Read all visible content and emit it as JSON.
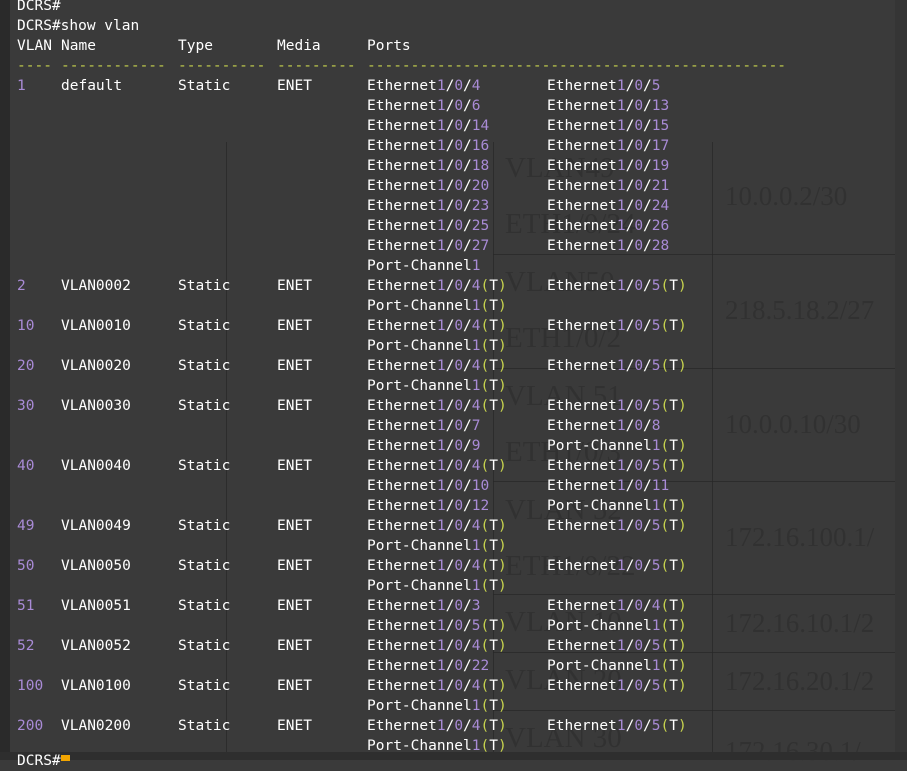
{
  "header_lines": [
    "DCRS#",
    "DCRS#show vlan"
  ],
  "columns": [
    "VLAN",
    "Name",
    "Type",
    "Media",
    "Ports"
  ],
  "separators": [
    "----",
    "------------",
    "----------",
    "---------",
    "------------------------------------------------"
  ],
  "vlans": [
    {
      "id": "1",
      "name": "default",
      "type": "Static",
      "media": "ENET",
      "port_lines": [
        [
          "Ethernet1/0/4",
          "Ethernet1/0/5"
        ],
        [
          "Ethernet1/0/6",
          "Ethernet1/0/13"
        ],
        [
          "Ethernet1/0/14",
          "Ethernet1/0/15"
        ],
        [
          "Ethernet1/0/16",
          "Ethernet1/0/17"
        ],
        [
          "Ethernet1/0/18",
          "Ethernet1/0/19"
        ],
        [
          "Ethernet1/0/20",
          "Ethernet1/0/21"
        ],
        [
          "Ethernet1/0/23",
          "Ethernet1/0/24"
        ],
        [
          "Ethernet1/0/25",
          "Ethernet1/0/26"
        ],
        [
          "Ethernet1/0/27",
          "Ethernet1/0/28"
        ],
        [
          "Port-Channel1"
        ]
      ]
    },
    {
      "id": "2",
      "name": "VLAN0002",
      "type": "Static",
      "media": "ENET",
      "port_lines": [
        [
          "Ethernet1/0/4(T)",
          "Ethernet1/0/5(T)"
        ],
        [
          "Port-Channel1(T)"
        ]
      ]
    },
    {
      "id": "10",
      "name": "VLAN0010",
      "type": "Static",
      "media": "ENET",
      "port_lines": [
        [
          "Ethernet1/0/4(T)",
          "Ethernet1/0/5(T)"
        ],
        [
          "Port-Channel1(T)"
        ]
      ]
    },
    {
      "id": "20",
      "name": "VLAN0020",
      "type": "Static",
      "media": "ENET",
      "port_lines": [
        [
          "Ethernet1/0/4(T)",
          "Ethernet1/0/5(T)"
        ],
        [
          "Port-Channel1(T)"
        ]
      ]
    },
    {
      "id": "30",
      "name": "VLAN0030",
      "type": "Static",
      "media": "ENET",
      "port_lines": [
        [
          "Ethernet1/0/4(T)",
          "Ethernet1/0/5(T)"
        ],
        [
          "Ethernet1/0/7",
          "Ethernet1/0/8"
        ],
        [
          "Ethernet1/0/9",
          "Port-Channel1(T)"
        ]
      ]
    },
    {
      "id": "40",
      "name": "VLAN0040",
      "type": "Static",
      "media": "ENET",
      "port_lines": [
        [
          "Ethernet1/0/4(T)",
          "Ethernet1/0/5(T)"
        ],
        [
          "Ethernet1/0/10",
          "Ethernet1/0/11"
        ],
        [
          "Ethernet1/0/12",
          "Port-Channel1(T)"
        ]
      ]
    },
    {
      "id": "49",
      "name": "VLAN0049",
      "type": "Static",
      "media": "ENET",
      "port_lines": [
        [
          "Ethernet1/0/4(T)",
          "Ethernet1/0/5(T)"
        ],
        [
          "Port-Channel1(T)"
        ]
      ]
    },
    {
      "id": "50",
      "name": "VLAN0050",
      "type": "Static",
      "media": "ENET",
      "port_lines": [
        [
          "Ethernet1/0/4(T)",
          "Ethernet1/0/5(T)"
        ],
        [
          "Port-Channel1(T)"
        ]
      ]
    },
    {
      "id": "51",
      "name": "VLAN0051",
      "type": "Static",
      "media": "ENET",
      "port_lines": [
        [
          "Ethernet1/0/3",
          "Ethernet1/0/4(T)"
        ],
        [
          "Ethernet1/0/5(T)",
          "Port-Channel1(T)"
        ]
      ]
    },
    {
      "id": "52",
      "name": "VLAN0052",
      "type": "Static",
      "media": "ENET",
      "port_lines": [
        [
          "Ethernet1/0/4(T)",
          "Ethernet1/0/5(T)"
        ],
        [
          "Ethernet1/0/22",
          "Port-Channel1(T)"
        ]
      ]
    },
    {
      "id": "100",
      "name": "VLAN0100",
      "type": "Static",
      "media": "ENET",
      "port_lines": [
        [
          "Ethernet1/0/4(T)",
          "Ethernet1/0/5(T)"
        ],
        [
          "Port-Channel1(T)"
        ]
      ]
    },
    {
      "id": "200",
      "name": "VLAN0200",
      "type": "Static",
      "media": "ENET",
      "port_lines": [
        [
          "Ethernet1/0/4(T)",
          "Ethernet1/0/5(T)"
        ],
        [
          "Port-Channel1(T)"
        ]
      ]
    }
  ],
  "bottom_prompt": "DCRS#",
  "colors": {
    "background": "#3a3a3a",
    "text": "#ffffff",
    "vlan_id": "#a98bd6",
    "digit": "#a98bd6",
    "paren": "#c7d34e",
    "separator": "#c7d34e",
    "cursor": "#f2a500"
  },
  "background_document": {
    "names": [
      "VLAN49",
      "ETH1/0/24",
      "VLAN50",
      "ETH1/0/2",
      "VLAN 51",
      "ETH1/0/3",
      "VLAN 52",
      "ETH1/0/22",
      "VLAN 10",
      "VLAN 20",
      "VLAN 30"
    ],
    "ips": [
      "10.0.0.2/30",
      "218.5.18.2/27",
      "10.0.0.10/30",
      "172.16.100.1/",
      "172.16.10.1/2",
      "172.16.20.1/2",
      "172.16.30.1/"
    ]
  }
}
